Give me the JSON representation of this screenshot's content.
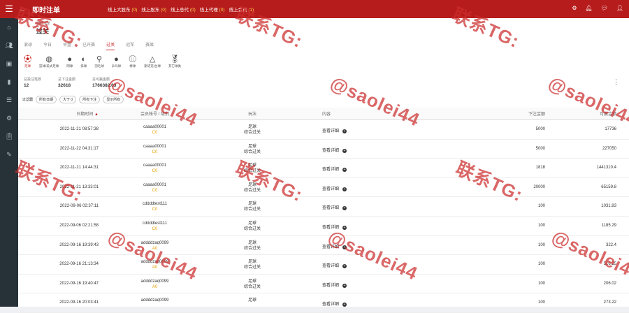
{
  "topbar": {
    "title": "即时注单",
    "onlines": [
      {
        "label": "线上大股东",
        "count": "(0)"
      },
      {
        "label": "线上股东",
        "count": "(0)"
      },
      {
        "label": "线上总代",
        "count": "(0)"
      },
      {
        "label": "线上代理",
        "count": "(0)"
      },
      {
        "label": "线上会员",
        "count": "(1)"
      }
    ]
  },
  "page": {
    "breadcrumb": "即时注单",
    "title": "过关"
  },
  "tabs": [
    "滚球",
    "今日",
    "早盘",
    "已开赛",
    "过关",
    "冠军",
    "赛果"
  ],
  "sports": [
    "足球",
    "篮球/美式足球",
    "网球",
    "排球",
    "羽毛球",
    "乒乓球",
    "棒球",
    "斯诺克/台球",
    "其它球类"
  ],
  "stats": [
    {
      "label": "总投注笔数",
      "value": "12"
    },
    {
      "label": "总下注金额",
      "value": "32618"
    },
    {
      "label": "总可赢金额",
      "value": "1766382.63"
    }
  ],
  "filters": {
    "label": "过滤器",
    "chips": [
      "所有日期",
      "大于 0",
      "所有下注",
      "显示所有"
    ]
  },
  "table": {
    "headers": {
      "date": "日期时间",
      "user": "会员帐号 / 级别",
      "play": "玩法",
      "content": "内容",
      "bet": "下注金额",
      "win": "可赢金额"
    },
    "rows": [
      {
        "date": "2022-11-21 08:57:38",
        "user": "caaaa00001",
        "level": "C0",
        "sport": "足球",
        "play": "综合过关",
        "content": "查看详细",
        "bet": "5000",
        "win": "17736"
      },
      {
        "date": "2022-11-22 04:31:17",
        "user": "caaaa00001",
        "level": "C0",
        "sport": "足球",
        "play": "综合过关",
        "content": "查看详细",
        "bet": "5000",
        "win": "227050"
      },
      {
        "date": "2022-11-21 14:44:31",
        "user": "caaaa00001",
        "level": "C0",
        "sport": "足球",
        "play": "综合过关",
        "content": "查看详细",
        "bet": "1818",
        "win": "1441310.4"
      },
      {
        "date": "2022-11-21 13:33:01",
        "user": "caaaa00001",
        "level": "C0",
        "sport": "足球",
        "play": "综合过关",
        "content": "查看详细",
        "bet": "20000",
        "win": "65159.8"
      },
      {
        "date": "2022-09-06 02:37:11",
        "user": "cddddtest111",
        "level": "C0",
        "sport": "足球",
        "play": "综合过关",
        "content": "查看详细",
        "bet": "100",
        "win": "1031.83"
      },
      {
        "date": "2022-09-06 02:21:58",
        "user": "cddddtest111",
        "level": "C0",
        "sport": "足球",
        "play": "综合过关",
        "content": "查看详细",
        "bet": "100",
        "win": "1185.29"
      },
      {
        "date": "2022-09-16 19:39:43",
        "user": "addddzaq0099",
        "level": "A0",
        "sport": "足球",
        "play": "综合过关",
        "content": "查看详细",
        "bet": "100",
        "win": "322.4"
      },
      {
        "date": "2022-09-16 21:13:34",
        "user": "addddzaq0099",
        "level": "A0",
        "sport": "足球",
        "play": "综合过关",
        "content": "查看详细",
        "bet": "100",
        "win": "516.25"
      },
      {
        "date": "2022-09-16 19:40:47",
        "user": "addddzaq0099",
        "level": "A0",
        "sport": "足球",
        "play": "综合过关",
        "content": "查看详细",
        "bet": "100",
        "win": "206.02"
      },
      {
        "date": "2022-09-16 20:03:41",
        "user": "addddzaq0099",
        "level": "",
        "sport": "足球",
        "play": "",
        "content": "查看详细",
        "bet": "100",
        "win": "273.22"
      }
    ]
  },
  "watermark": {
    "line1": "联系TG:",
    "line2": "@saolei44"
  },
  "colors": {
    "header": "#b71c1c",
    "sidebar": "#263238",
    "accent": "#c62828",
    "level": "#e6a100"
  }
}
